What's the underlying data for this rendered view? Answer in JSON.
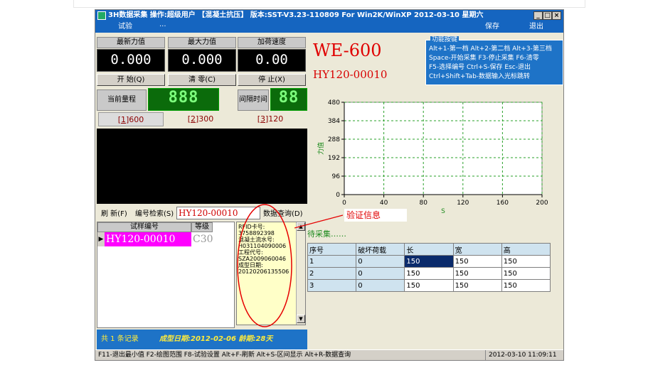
{
  "window": {
    "title": "3H数据采集 操作:超级用户 【混凝土抗压】 版本:SST-V3.23-110809 For Win2K/WinXP  2012-03-10 星期六",
    "controls": [
      "_",
      "□",
      "×"
    ]
  },
  "menu": {
    "left": [
      "试验",
      "···"
    ],
    "right": [
      "保存",
      "退出"
    ]
  },
  "readings": {
    "latest_force": {
      "label": "最新力值",
      "value": "0.000"
    },
    "max_force": {
      "label": "最大力值",
      "value": "0.000"
    },
    "load_speed": {
      "label": "加荷速度",
      "value": "0.00"
    }
  },
  "buttons": {
    "start": "开 始(Q)",
    "zero": "清 零(C)",
    "stop": "停 止(X)"
  },
  "range": {
    "label": "当前量程",
    "display": "888",
    "interval_label": "间隔时间",
    "interval_display": "88"
  },
  "range_tabs": [
    {
      "key": "1",
      "value": "600"
    },
    {
      "key": "2",
      "value": "300"
    },
    {
      "key": "3",
      "value": "120"
    }
  ],
  "machine": {
    "model": "WE-600",
    "sample": "HY120-00010"
  },
  "function_keys": {
    "title": "功能按键",
    "lines": [
      "Alt+1-第一档 Alt+2-第二档 Alt+3-第三档",
      "Space-开始采集 F3-停止采集 F6-清零",
      "F5-选择编号 Ctrl+S-保存 Esc-退出",
      "Ctrl+Shift+Tab-数据输入光标跳转"
    ]
  },
  "search": {
    "refresh": "刷 新(F)",
    "search_label": "编号检索(S)",
    "value": "HY120-00010",
    "query": "数据查询(D)"
  },
  "sample_list": {
    "headers": [
      "试样编号",
      "等级"
    ],
    "rows": [
      {
        "id": "HY120-00010",
        "grade": "C30"
      }
    ]
  },
  "rfid": {
    "lines": [
      "RFID卡号:",
      "3758892398",
      "混凝土流水号:",
      "H031104090006",
      "工程代号:",
      "SZA2009060046",
      "成型日期:",
      "20120206135506"
    ]
  },
  "callout": "验证信息",
  "status_left": {
    "count": "共 1 条记录",
    "info": "成型日期:2012-02-06 龄期:28天"
  },
  "wait_label": "待采集……",
  "results": {
    "headers": [
      "序号",
      "破坏荷载",
      "长",
      "宽",
      "高"
    ],
    "rows": [
      [
        "1",
        "0",
        "150",
        "150",
        "150"
      ],
      [
        "2",
        "0",
        "150",
        "150",
        "150"
      ],
      [
        "3",
        "0",
        "150",
        "150",
        "150"
      ]
    ]
  },
  "statusbar": {
    "hints": "F11-退出最小值 F2-绘图范围 F8-试验设置  Alt+F-刷新 Alt+S-区间显示 Alt+R-数据查询",
    "datetime": "2012-03-10  11:09:11"
  },
  "colors": {
    "titlebar": "#1565c0",
    "accent_red": "#e00000",
    "sample_highlight": "#ff00ff",
    "selected_cell": "#0a2a6b",
    "lcd_green": "#0b6b0b"
  },
  "chart_data": {
    "type": "line",
    "xlabel": "S",
    "ylabel": "力值",
    "xlim": [
      0,
      200
    ],
    "ylim": [
      0,
      480
    ],
    "xticks": [
      0,
      40,
      80,
      120,
      160,
      200
    ],
    "yticks": [
      0,
      96,
      192,
      288,
      384,
      480
    ],
    "grid": true,
    "series": []
  }
}
